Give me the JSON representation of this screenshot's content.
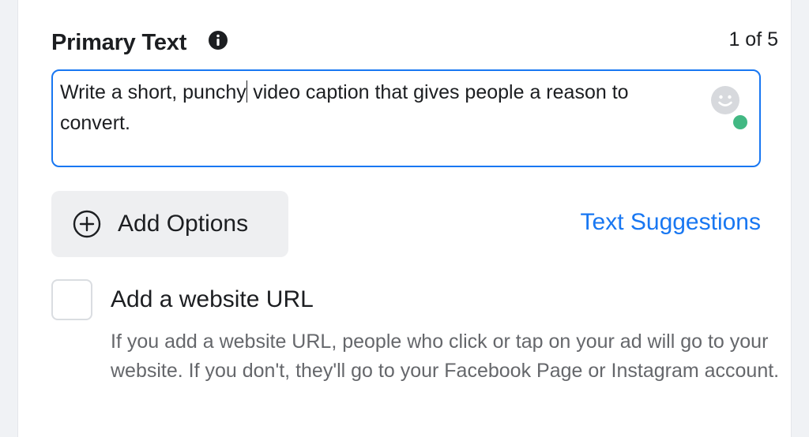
{
  "primary_text": {
    "title": "Primary Text",
    "info_icon": "info-icon",
    "counter": "1 of 5",
    "value_before_caret": "Write a short, punchy",
    "value_after_caret": "video caption that gives people a reason to convert.",
    "emoji_icon": "smiley-icon",
    "status_color": "#42b883",
    "focus_color": "#1877f2"
  },
  "add_options": {
    "icon": "plus-circle-icon",
    "label": "Add Options"
  },
  "text_suggestions": {
    "label": "Text Suggestions",
    "color": "#1877f2"
  },
  "website_url": {
    "checked": false,
    "label": "Add a website URL",
    "helper": "If you add a website URL, people who click or tap on your ad will go to your website. If you don't, they'll go to your Facebook Page or Instagram account."
  }
}
